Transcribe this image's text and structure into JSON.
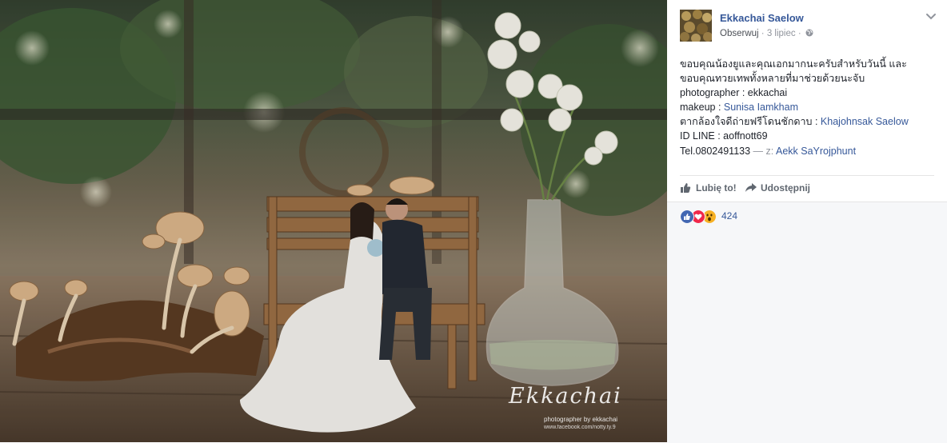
{
  "post": {
    "author": "Ekkachai Saelow",
    "follow_label": "Obserwuj",
    "dot": " · ",
    "date": "3 lipiec",
    "dot2": " · ",
    "privacy_icon": "globe-icon",
    "menu_icon": "chevron-down-icon",
    "caption": {
      "line1": "ขอบคุณน้องยูและคุณเอกมากนะครับสำหรับวันนี้ และ",
      "line2": "ขอบคุณทวยเทพทั้งหลายที่มาช่วยด้วยนะจับ",
      "line3": "photographer : ekkachai",
      "line4_prefix": "makeup : ",
      "line4_link": "Sunisa Iamkham",
      "line5_prefix": "ตากล้องใจดีถ่ายฟรีโดนชักดาบ : ",
      "line5_link": "Khajohnsak Saelow",
      "line6": "ID LINE : aoffnott69",
      "line7_prefix": "Tel.0802491133",
      "line7_with": " — z: ",
      "line7_link": "Aekk SaYrojphunt"
    },
    "actions": {
      "like_label": "Lubię to!",
      "like_icon": "thumbs-up-icon",
      "share_label": "Udostępnij",
      "share_icon": "share-arrow-icon"
    },
    "reactions": {
      "icons": [
        "like-reaction-icon",
        "love-reaction-icon",
        "wow-reaction-icon"
      ],
      "count": "424"
    }
  },
  "photo": {
    "watermark_logo": "Ekkachai",
    "watermark_sub": "photographer by ekkachai",
    "watermark_url": "www.facebook.com/notty.ty.9"
  },
  "colors": {
    "link": "#365899",
    "meta": "#90949c",
    "like_blue": "#4267b2",
    "love_red": "#f0284a",
    "wow_yellow": "#f7b125"
  }
}
